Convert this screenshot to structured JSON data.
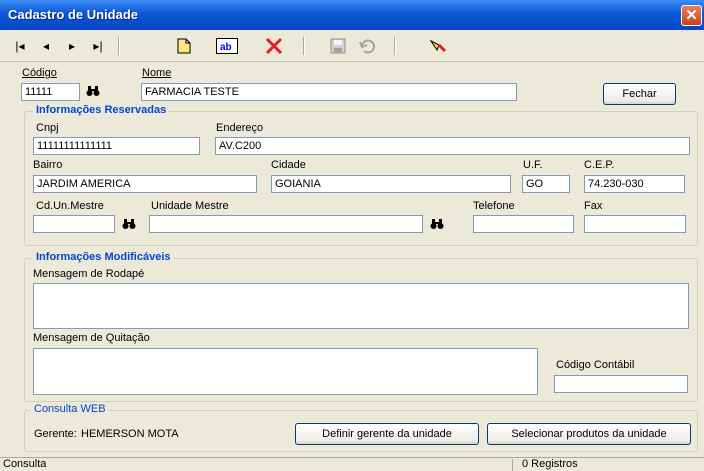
{
  "window": {
    "title": "Cadastro de Unidade",
    "close_glyph": "✕"
  },
  "toolbar": {
    "first": "|◂",
    "prev": "◂",
    "next": "▸",
    "last": "▸|",
    "new_icon": "new-document-icon",
    "edit_icon": "edit-field-icon",
    "delete_icon": "delete-x-icon",
    "save_icon": "save-disk-icon",
    "undo_icon": "undo-icon",
    "search_icon": "search-flashlight-icon",
    "accent_delete": "#e02020"
  },
  "header": {
    "codigo_label": "Código",
    "codigo_value": "11111",
    "nome_label": "Nome",
    "nome_value": "FARMACIA TESTE",
    "fechar_label": "Fechar"
  },
  "reservadas": {
    "title": "Informações Reservadas",
    "cnpj_label": "Cnpj",
    "cnpj_value": "11111111111111",
    "endereco_label": "Endereço",
    "endereco_value": "AV.C200",
    "bairro_label": "Bairro",
    "bairro_value": "JARDIM AMERICA",
    "cidade_label": "Cidade",
    "cidade_value": "GOIANIA",
    "uf_label": "U.F.",
    "uf_value": "GO",
    "cep_label": "C.E.P.",
    "cep_value": "74.230-030",
    "cdun_label": "Cd.Un.Mestre",
    "cdun_value": "",
    "unidade_label": "Unidade Mestre",
    "unidade_value": "",
    "telefone_label": "Telefone",
    "telefone_value": "",
    "fax_label": "Fax",
    "fax_value": ""
  },
  "modificaveis": {
    "title": "Informações Modificáveis",
    "rodape_label": "Mensagem de Rodapé",
    "quitacao_label": "Mensagem de Quitação",
    "contabil_label": "Código Contábil",
    "contabil_value": ""
  },
  "web": {
    "title": "Consulta WEB",
    "gerente_label": "Gerente:",
    "gerente_value": "HEMERSON MOTA",
    "definir_label": "Definir gerente da unidade",
    "selecionar_label": "Selecionar produtos da unidade"
  },
  "status": {
    "mode": "Consulta",
    "records": "0 Registros"
  }
}
